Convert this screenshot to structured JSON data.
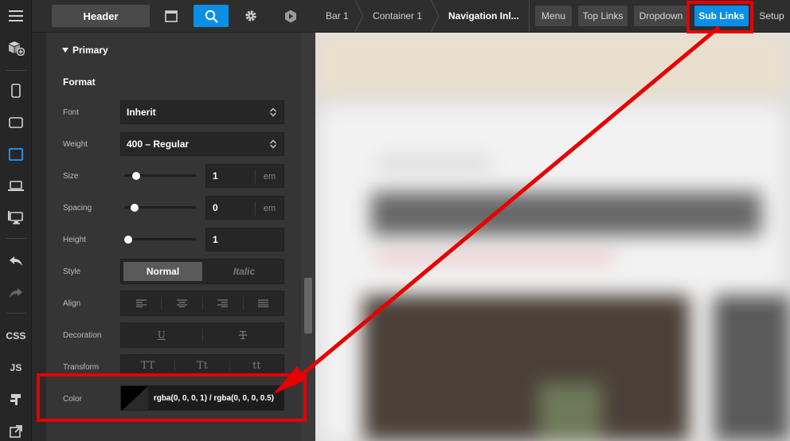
{
  "rail": {
    "items": [
      {
        "name": "menu-icon"
      },
      {
        "name": "add-element-icon"
      },
      {
        "name": "phone-portrait-icon"
      },
      {
        "name": "phone-landscape-icon"
      },
      {
        "name": "tablet-icon"
      },
      {
        "name": "laptop-icon"
      },
      {
        "name": "desktop-icon"
      },
      {
        "name": "undo-icon"
      },
      {
        "name": "redo-icon"
      }
    ],
    "css_label": "CSS",
    "js_label": "JS"
  },
  "toolbar": {
    "header_label": "Header",
    "buttons": [
      "window-icon",
      "search-icon",
      "gear-icon",
      "hexagon-icon"
    ],
    "active_color": "#0a8fe6"
  },
  "section": {
    "title": "Primary",
    "subtitle": "Format"
  },
  "format": {
    "font_label": "Font",
    "font_value": "Inherit",
    "weight_label": "Weight",
    "weight_value": "400 – Regular",
    "size_label": "Size",
    "size_value": "1",
    "size_unit": "em",
    "size_slider_fraction": 0.13,
    "spacing_label": "Spacing",
    "spacing_value": "0",
    "spacing_unit": "em",
    "spacing_slider_fraction": 0.1,
    "height_label": "Height",
    "height_value": "1",
    "height_slider_fraction": 0.0,
    "style_label": "Style",
    "style_normal": "Normal",
    "style_italic": "Italic",
    "align_label": "Align",
    "decoration_label": "Decoration",
    "decoration_underline": "U",
    "transform_label": "Transform",
    "transform_upper": "TT",
    "transform_capitalize": "Tt",
    "transform_lower": "tt",
    "color_label": "Color",
    "color_value": "rgba(0, 0, 0, 1) / rgba(0, 0, 0, 0.5)"
  },
  "breadcrumb": {
    "items": [
      "Bar 1",
      "Container 1",
      "Navigation Inl..."
    ]
  },
  "tags": {
    "items": [
      "Menu",
      "Top Links",
      "Dropdown",
      "Sub Links",
      "Setup"
    ],
    "active": "Sub Links"
  },
  "annotation_color": "#e60000"
}
